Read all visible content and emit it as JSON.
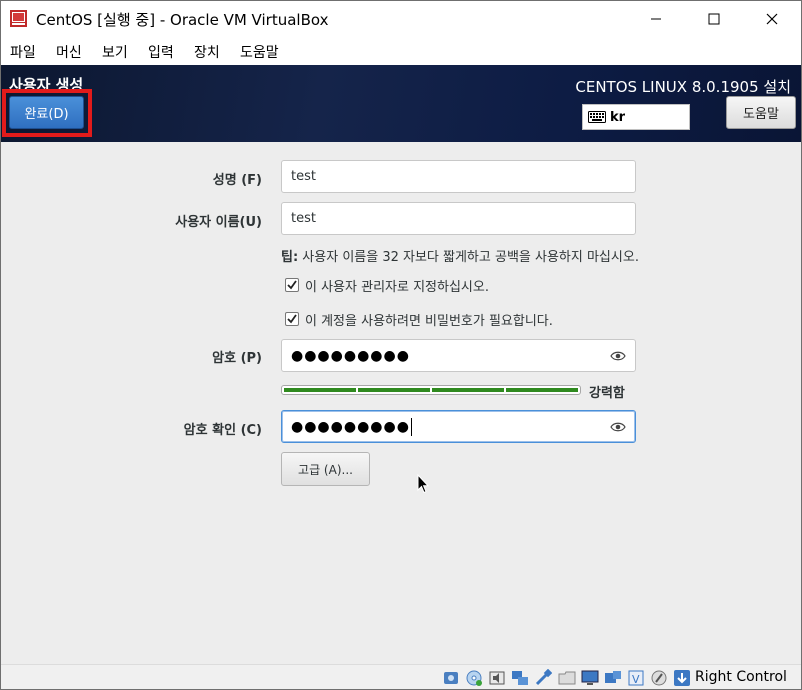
{
  "window": {
    "title": "CentOS [실행 중] - Oracle VM VirtualBox"
  },
  "menu": [
    "파일",
    "머신",
    "보기",
    "입력",
    "장치",
    "도움말"
  ],
  "header": {
    "title": "사용자 생성",
    "done_label": "완료(D)",
    "product": "CENTOS LINUX 8.0.1905 설치",
    "keyboard": "kr",
    "help_label": "도움말"
  },
  "form": {
    "fullname_label": "성명 (F)",
    "fullname_value": "test",
    "username_label": "사용자 이름(U)",
    "username_value": "test",
    "tip_prefix": "팁:",
    "tip_text": " 사용자 이름을 32 자보다 짧게하고 공백을 사용하지 마십시오.",
    "admin_checkbox": {
      "label": "이 사용자 관리자로 지정하십시오.",
      "checked": true
    },
    "password_required_checkbox": {
      "label": "이 계정을 사용하려면 비밀번호가 필요합니다.",
      "checked": true
    },
    "password_label": "암호 (P)",
    "password_value": "●●●●●●●●●",
    "strength": {
      "level": 1.0,
      "label": "강력함",
      "color": "#2f8a1f"
    },
    "confirm_label": "암호 확인 (C)",
    "confirm_value": "●●●●●●●●●",
    "advanced_label": "고급 (A)..."
  },
  "statusbar": {
    "host_key": "Right Control"
  },
  "colors": {
    "header_bg": "#15244a",
    "done_button": "#2f6fc0",
    "highlight_frame": "#e21b1b",
    "focus_border": "#4a90d9"
  }
}
